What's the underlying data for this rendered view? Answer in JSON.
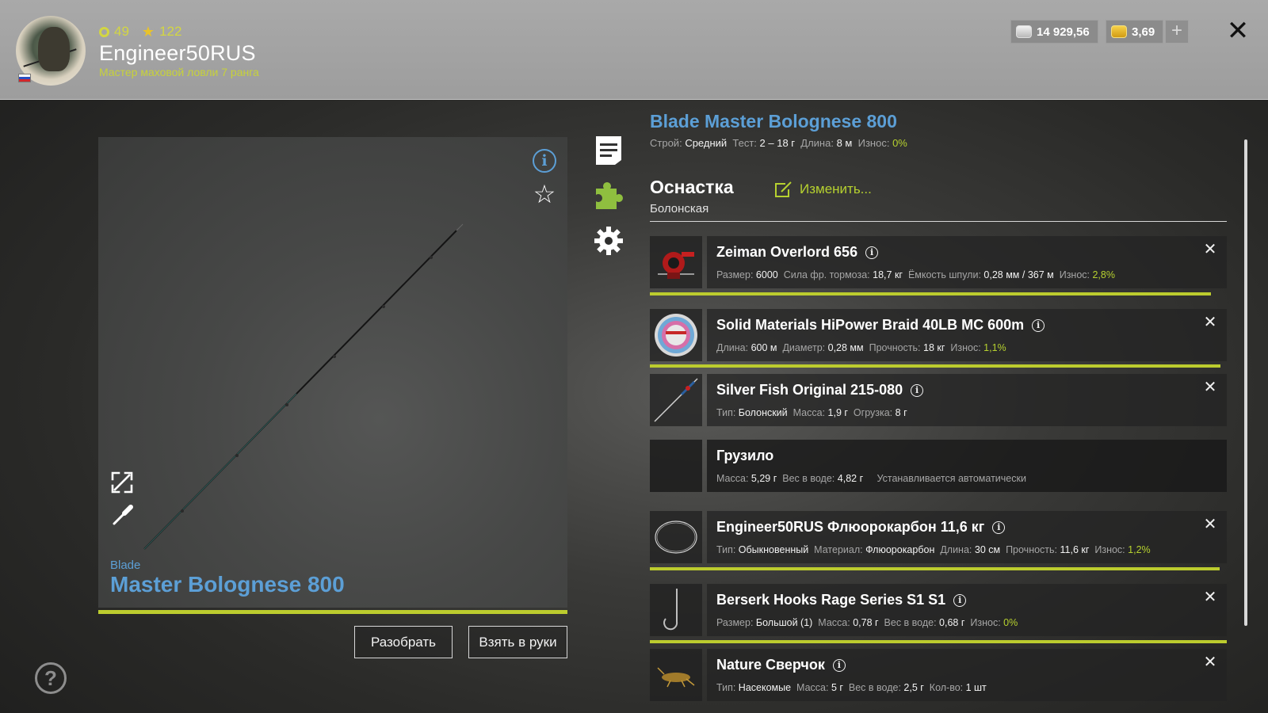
{
  "player": {
    "level": "49",
    "rank_points": "122",
    "name": "Engineer50RUS",
    "rank_title": "Мастер маховой ловли 7 ранга"
  },
  "currency": {
    "silver": "14 929,56",
    "gold": "3,69",
    "add_label": "+"
  },
  "close_label": "✕",
  "rod": {
    "title": "Blade Master Bolognese 800",
    "brand": "Blade",
    "model": "Master Bolognese 800",
    "stats": [
      {
        "label": "Строй:",
        "value": "Средний"
      },
      {
        "label": "Тест:",
        "value": "2 – 18 г"
      },
      {
        "label": "Длина:",
        "value": "8 м"
      },
      {
        "label": "Износ:",
        "value": "0%"
      }
    ]
  },
  "buttons": {
    "disassemble": "Разобрать",
    "take_in_hands": "Взять в руки"
  },
  "rig": {
    "title": "Оснастка",
    "subtitle": "Болонская",
    "edit_label": "Изменить..."
  },
  "items": [
    {
      "name": "Zeiman Overlord 656",
      "stats": [
        {
          "label": "Размер:",
          "value": "6000"
        },
        {
          "label": "Сила фр. тормоза:",
          "value": "18,7 кг"
        },
        {
          "label": "Ёмкость шпули:",
          "value": "0,28 мм / 367 м"
        },
        {
          "label": "Износ:",
          "value": "2,8%"
        }
      ],
      "wear_fill": 0.972,
      "icon": "reel-icon"
    },
    {
      "name": "Solid Materials HiPower Braid 40LB MC 600m",
      "stats": [
        {
          "label": "Длина:",
          "value": "600 м"
        },
        {
          "label": "Диаметр:",
          "value": "0,28 мм"
        },
        {
          "label": "Прочность:",
          "value": "18 кг"
        },
        {
          "label": "Износ:",
          "value": "1,1%"
        }
      ],
      "wear_fill": 0.989,
      "icon": "line-spool-icon"
    },
    {
      "name": "Silver Fish Original 215-080",
      "stats": [
        {
          "label": "Тип:",
          "value": "Болонский"
        },
        {
          "label": "Масса:",
          "value": "1,9 г"
        },
        {
          "label": "Огрузка:",
          "value": "8 г"
        }
      ],
      "icon": "float-icon"
    },
    {
      "name": "Грузило",
      "stats": [
        {
          "label": "Масса:",
          "value": "5,29 г"
        },
        {
          "label": "Вес в воде:",
          "value": "4,82 г"
        }
      ],
      "note": "Устанавливается автоматически",
      "icon": "sinker-icon"
    },
    {
      "name": "Engineer50RUS Флюорокарбон 11,6 кг",
      "stats": [
        {
          "label": "Тип:",
          "value": "Обыкновенный"
        },
        {
          "label": "Материал:",
          "value": "Флюорокарбон"
        },
        {
          "label": "Длина:",
          "value": "30 см"
        },
        {
          "label": "Прочность:",
          "value": "11,6 кг"
        },
        {
          "label": "Износ:",
          "value": "1,2%"
        }
      ],
      "wear_fill": 0.988,
      "icon": "leader-icon"
    },
    {
      "name": "Berserk Hooks Rage Series S1 S1",
      "stats": [
        {
          "label": "Размер:",
          "value": "Большой (1)"
        },
        {
          "label": "Масса:",
          "value": "0,78 г"
        },
        {
          "label": "Вес в воде:",
          "value": "0,68 г"
        },
        {
          "label": "Износ:",
          "value": "0%"
        }
      ],
      "wear_fill": 1.0,
      "icon": "hook-icon"
    },
    {
      "name": "Nature Сверчок",
      "stats": [
        {
          "label": "Тип:",
          "value": "Насекомые"
        },
        {
          "label": "Масса:",
          "value": "5 г"
        },
        {
          "label": "Вес в воде:",
          "value": "2,5 г"
        },
        {
          "label": "Кол-во:",
          "value": "1 шт"
        }
      ],
      "icon": "cricket-bait-icon"
    }
  ],
  "colors": {
    "accent_blue": "#5c9fd6",
    "accent_green": "#b6d12f",
    "wear_bar": "#bccc2e"
  },
  "icons": {
    "info": "info-icon",
    "favorite": "star-icon",
    "expand": "expand-icon",
    "customize": "brush-icon",
    "description": "document-icon",
    "rig": "puzzle-icon",
    "settings": "gear-icon",
    "help": "help-icon"
  }
}
